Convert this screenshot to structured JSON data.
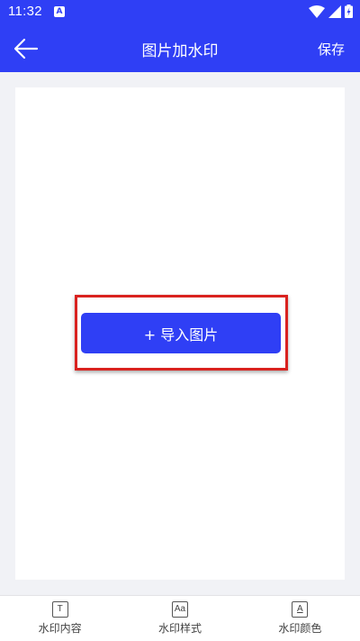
{
  "status_bar": {
    "time": "11:32",
    "notification_icon": "A",
    "icons": [
      "wifi-icon",
      "signal-icon",
      "battery-charging-icon"
    ]
  },
  "app_bar": {
    "back_icon": "arrow-left-icon",
    "title": "图片加水印",
    "save_label": "保存"
  },
  "canvas": {
    "import_button_label": "+ 导入图片"
  },
  "bottom_nav": {
    "items": [
      {
        "label": "水印内容",
        "icon": "text-T-icon",
        "glyph": "T"
      },
      {
        "label": "水印样式",
        "icon": "font-style-icon",
        "glyph": "Aa"
      },
      {
        "label": "水印颜色",
        "icon": "font-color-icon",
        "glyph": "A"
      }
    ]
  },
  "colors": {
    "primary": "#2f3ff5",
    "background": "#f1f2f6",
    "highlight": "#d9221f"
  }
}
